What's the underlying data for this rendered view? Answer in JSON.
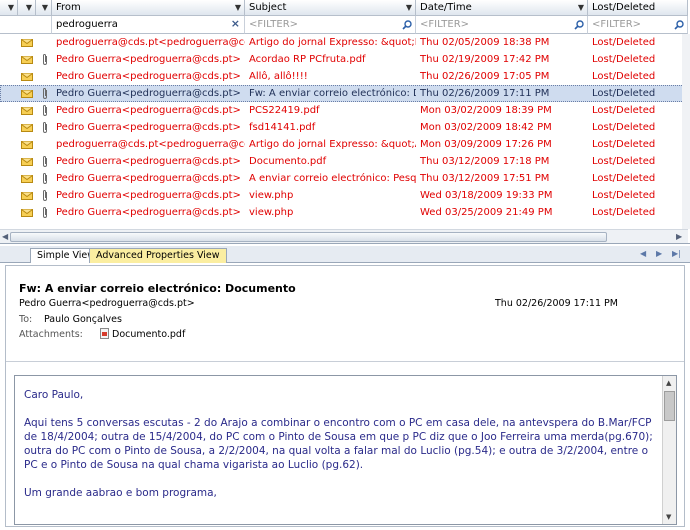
{
  "columns": {
    "from": "From",
    "subject": "Subject",
    "date": "Date/Time",
    "lost": "Lost/Deleted"
  },
  "filters": {
    "from_value": "pedroguerra",
    "subject_placeholder": "<FILTER>",
    "date_placeholder": "<FILTER>",
    "lost_placeholder": "<FILTER>"
  },
  "messages": [
    {
      "from": "pedroguerra@cds.pt<pedroguerra@cds.pt>",
      "subject": "Artigo do jornal Expresso: &quot;No Na...",
      "date": "Thu 02/05/2009 18:38 PM",
      "lost": "Lost/Deleted",
      "attachment": false,
      "selected": false
    },
    {
      "from": "Pedro Guerra<pedroguerra@cds.pt>",
      "subject": "Acordao RP PCfruta.pdf",
      "date": "Thu 02/19/2009 17:42 PM",
      "lost": "Lost/Deleted",
      "attachment": true,
      "selected": false
    },
    {
      "from": "Pedro Guerra<pedroguerra@cds.pt>",
      "subject": "Allô, allô!!!!",
      "date": "Thu 02/26/2009 17:05 PM",
      "lost": "Lost/Deleted",
      "attachment": false,
      "selected": false
    },
    {
      "from": "Pedro Guerra<pedroguerra@cds.pt>",
      "subject": "Fw: A enviar correio electrónico: Docu...",
      "date": "Thu 02/26/2009 17:11 PM",
      "lost": "Lost/Deleted",
      "attachment": true,
      "selected": true
    },
    {
      "from": "Pedro Guerra<pedroguerra@cds.pt>",
      "subject": "PCS22419.pdf",
      "date": "Mon 03/02/2009 18:39 PM",
      "lost": "Lost/Deleted",
      "attachment": true,
      "selected": false
    },
    {
      "from": "Pedro Guerra<pedroguerra@cds.pt>",
      "subject": "fsd14141.pdf",
      "date": "Mon 03/02/2009 18:42 PM",
      "lost": "Lost/Deleted",
      "attachment": true,
      "selected": false
    },
    {
      "from": "pedroguerra@cds.pt<pedroguerra@cds.pt>",
      "subject": "Artigo do jornal Expresso: &quot;Apito ...",
      "date": "Mon 03/09/2009 17:26 PM",
      "lost": "Lost/Deleted",
      "attachment": false,
      "selected": false
    },
    {
      "from": "Pedro Guerra<pedroguerra@cds.pt>",
      "subject": "Documento.pdf",
      "date": "Thu 03/12/2009 17:18 PM",
      "lost": "Lost/Deleted",
      "attachment": true,
      "selected": false
    },
    {
      "from": "Pedro Guerra<pedroguerra@cds.pt>",
      "subject": "A enviar correio electrónico: Pesquisa",
      "date": "Thu 03/12/2009 17:51 PM",
      "lost": "Lost/Deleted",
      "attachment": true,
      "selected": false
    },
    {
      "from": "Pedro Guerra<pedroguerra@cds.pt>",
      "subject": "view.php",
      "date": "Wed 03/18/2009 19:33 PM",
      "lost": "Lost/Deleted",
      "attachment": true,
      "selected": false
    },
    {
      "from": "Pedro Guerra<pedroguerra@cds.pt>",
      "subject": "view.php",
      "date": "Wed 03/25/2009 21:49 PM",
      "lost": "Lost/Deleted",
      "attachment": true,
      "selected": false
    }
  ],
  "tabs": {
    "simple": "Simple View",
    "advanced": "Advanced Properties View"
  },
  "preview": {
    "subject": "Fw: A enviar correio electrónico: Documento",
    "from": "Pedro Guerra<pedroguerra@cds.pt>",
    "date": "Thu 02/26/2009 17:11 PM",
    "to_label": "To:",
    "to": "Paulo Gonçalves",
    "attachments_label": "Attachments:",
    "attachment": "Documento.pdf",
    "body": [
      "Caro Paulo,",
      "Aqui tens 5 conversas escutas - 2 do Arajo a combinar o encontro com o PC em casa dele, na antevspera do B.Mar/FCP de 18/4/2004; outra de 15/4/2004, do PC com o Pinto de Sousa em que p PC diz que o Joo Ferreira uma merda(pg.670); outra do PC com o Pinto de Sousa, a 2/2/2004, na qual volta a falar mal do Luclio (pg.54); e outra de 3/2/2004, entre o PC e o Pinto de Sousa na qual chama vigarista ao Luclio (pg.62).",
      "Um grande aabrao e bom programa,"
    ]
  },
  "colors": {
    "deleted_text": "#e00000",
    "selected_row": "#cfdcef",
    "advanced_tab": "#fbeea1",
    "body_text": "#2a2a8a"
  }
}
